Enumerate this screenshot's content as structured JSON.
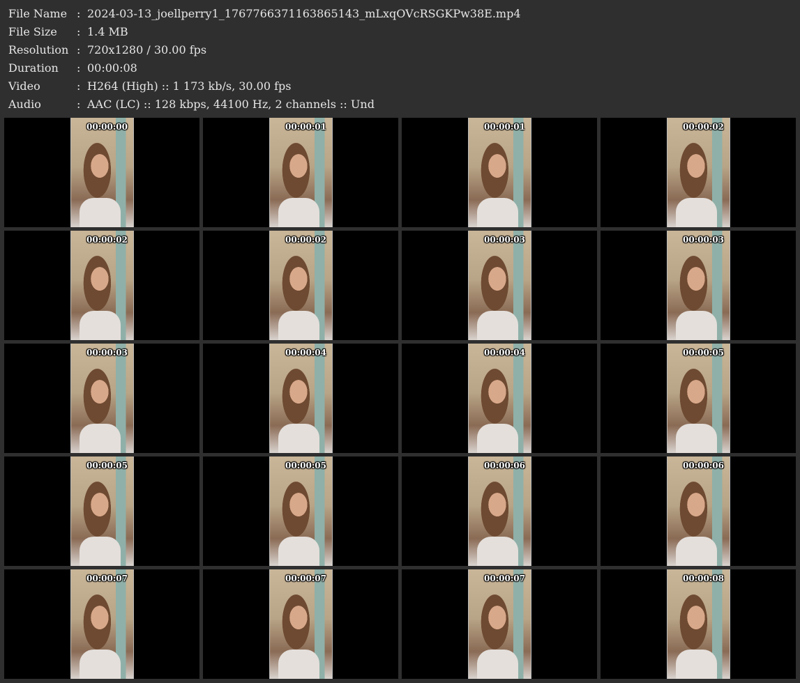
{
  "info": {
    "rows": [
      {
        "label": "File Name",
        "value": "2024-03-13_joellperry1_1767766371163865143_mLxqOVcRSGKPw38E.mp4"
      },
      {
        "label": "File Size",
        "value": "1.4 MB"
      },
      {
        "label": "Resolution",
        "value": "720x1280 / 30.00 fps"
      },
      {
        "label": "Duration",
        "value": "00:00:08"
      },
      {
        "label": "Video",
        "value": "H264 (High) :: 1 173 kb/s, 30.00 fps"
      },
      {
        "label": "Audio",
        "value": "AAC (LC) :: 128 kbps, 44100 Hz, 2 channels :: Und"
      }
    ],
    "separator": ":"
  },
  "thumbnails": [
    {
      "time": "00:00:00"
    },
    {
      "time": "00:00:01"
    },
    {
      "time": "00:00:01"
    },
    {
      "time": "00:00:02"
    },
    {
      "time": "00:00:02"
    },
    {
      "time": "00:00:02"
    },
    {
      "time": "00:00:03"
    },
    {
      "time": "00:00:03"
    },
    {
      "time": "00:00:03"
    },
    {
      "time": "00:00:04"
    },
    {
      "time": "00:00:04"
    },
    {
      "time": "00:00:05"
    },
    {
      "time": "00:00:05"
    },
    {
      "time": "00:00:05"
    },
    {
      "time": "00:00:06"
    },
    {
      "time": "00:00:06"
    },
    {
      "time": "00:00:07"
    },
    {
      "time": "00:00:07"
    },
    {
      "time": "00:00:07"
    },
    {
      "time": "00:00:08"
    }
  ],
  "colors": {
    "background": "#2f2f2f",
    "cell_background": "#000000",
    "text": "#e6e6e6"
  }
}
